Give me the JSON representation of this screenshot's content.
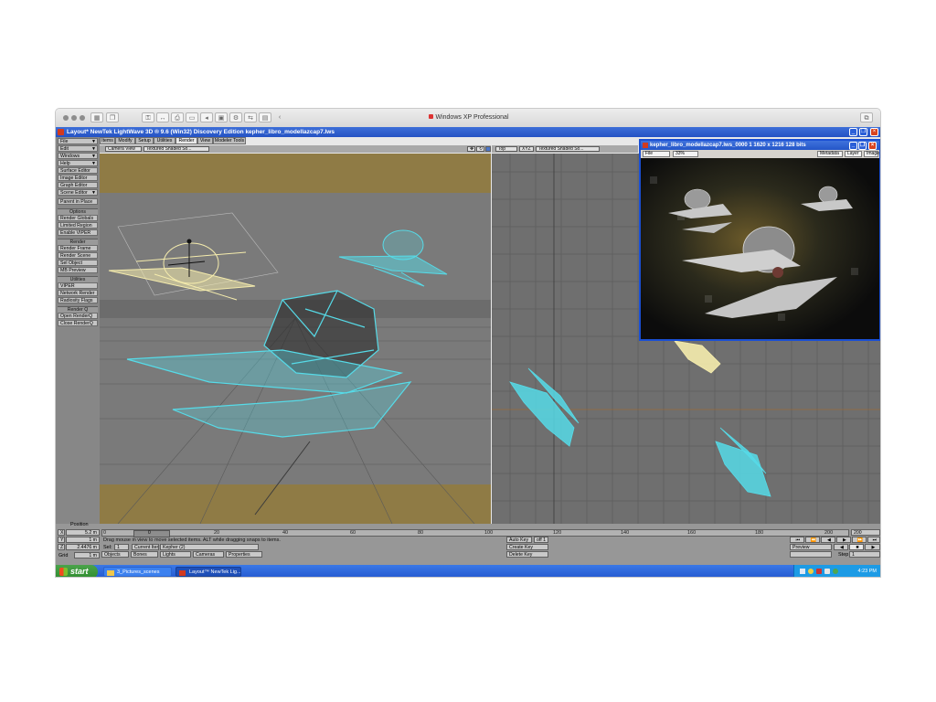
{
  "host": {
    "title": "Windows XP Professional"
  },
  "app": {
    "title": "Layout* NewTek LightWave 3D ® 9.6  (Win32) Discovery Edition  kepher_libro_modellazcap7.lws"
  },
  "menu": {
    "items": [
      "File",
      "Edit",
      "Windows",
      "Help",
      "Surface Editor",
      "Image Editor",
      "Graph Editor",
      "Scene Editor",
      "Parent in Place"
    ],
    "options_label": "Options",
    "options_items": [
      "Render Globals",
      "Limited Region",
      "Enable VIPER"
    ],
    "render_label": "Render",
    "render_items": [
      "Render Frame",
      "Render Scene",
      "Sel Object",
      "MB Preview"
    ],
    "utilities_label": "Utilities",
    "utilities_items": [
      "VIPER",
      "Network Render",
      "Radiosity Flags"
    ],
    "renderq_label": "Render Q",
    "renderq_items": [
      "Open RenderQ",
      "Close RenderQ"
    ]
  },
  "tabs": [
    {
      "label": "Items",
      "active": false
    },
    {
      "label": "Modify",
      "active": false
    },
    {
      "label": "Setup",
      "active": false
    },
    {
      "label": "Utilities",
      "active": false
    },
    {
      "label": "Render",
      "active": true
    },
    {
      "label": "View",
      "active": false
    },
    {
      "label": "Modeler Tools",
      "active": false
    }
  ],
  "viewport_left": {
    "view": "Camera View",
    "shading": "Textured Shaded So..."
  },
  "viewport_right": {
    "view": "Top",
    "icon": "XYZ",
    "shading": "Textured Shaded So..."
  },
  "render_window": {
    "title": "kepher_libro_modellazcap7.lws_0000 1   1620 x 1216 128 bits",
    "menu": {
      "file": "File",
      "zoom": "33%",
      "metadata": "Metadata",
      "layer": "Layer",
      "image": "Image"
    }
  },
  "bottom": {
    "position_label": "Position",
    "x_label": "X",
    "x_value": "5.2 m",
    "y_label": "Y",
    "y_value": "1 m",
    "z_label": "Z",
    "z_value": "2.4476 m",
    "grid_label": "Grid",
    "grid_value": "1 m",
    "hint": "Drag mouse in view to move selected items. ALT while dragging snaps to items.",
    "current_frame": "0",
    "ticks": [
      "0",
      "20",
      "40",
      "60",
      "80",
      "100",
      "120",
      "140",
      "160",
      "180",
      "200"
    ],
    "end_frame": "200",
    "sel_label": "Sel:",
    "sel_value": "1",
    "current_item_label": "Current Item",
    "current_item_value": "Kepher (2)",
    "objects_label": "Objects",
    "bones_label": "Bones",
    "lights_label": "Lights",
    "cameras_label": "Cameras",
    "properties_label": "Properties",
    "auto_key_label": "Auto Key",
    "auto_key_value": "off 1",
    "create_key_label": "Create Key",
    "delete_key_label": "Delete Key",
    "preview_label": "Preview",
    "step_label": "Step",
    "step_value": "1"
  },
  "taskbar": {
    "start_label": "start",
    "tasks": [
      "3_Pictures_scenes",
      "Layout™ NewTek Lig..."
    ],
    "clock": "4:23 PM"
  },
  "colors": {
    "selected_object": "#f5ecad",
    "scene_object": "#56dbe8",
    "viewport_gray": "#7a7a7a",
    "camera_border": "#8f7b45",
    "xp_blue": "#2552c4"
  }
}
